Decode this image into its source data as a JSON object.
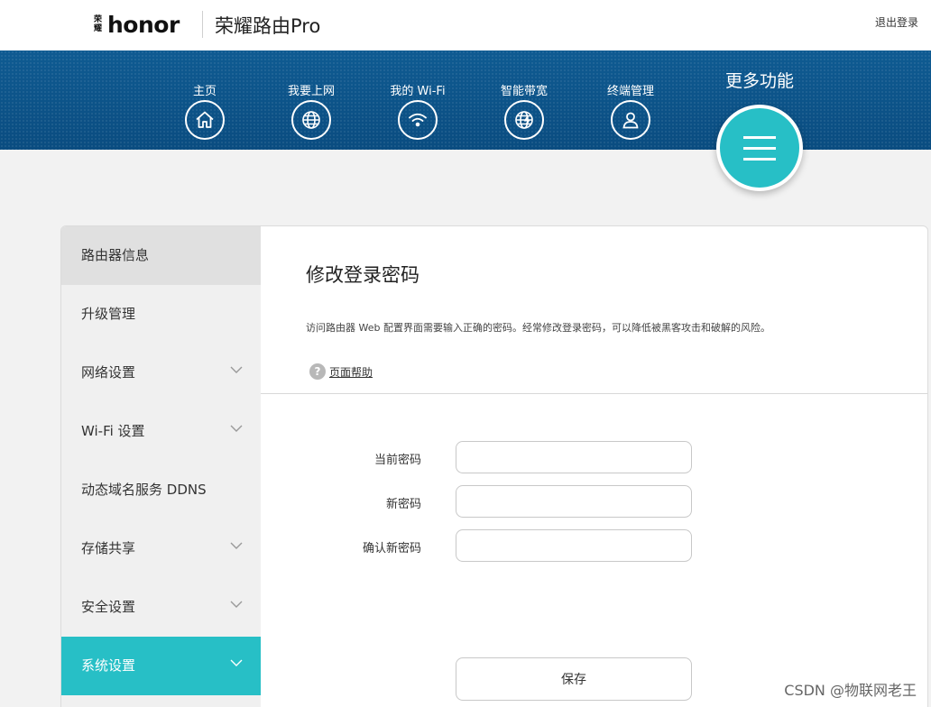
{
  "header": {
    "logo_mark": "荣耀",
    "logo_text": "honor",
    "product_title": "荣耀路由Pro",
    "logout_label": "退出登录"
  },
  "nav": {
    "items": [
      {
        "label": "主页",
        "icon": "home-icon"
      },
      {
        "label": "我要上网",
        "icon": "globe-icon"
      },
      {
        "label": "我的 Wi-Fi",
        "icon": "wifi-icon"
      },
      {
        "label": "智能带宽",
        "icon": "bandwidth-globe-icon"
      },
      {
        "label": "终端管理",
        "icon": "user-icon"
      }
    ],
    "more_label": "更多功能",
    "more_icon": "menu-icon"
  },
  "sidebar": {
    "items": [
      {
        "label": "路由器信息",
        "expandable": false,
        "state": "selected"
      },
      {
        "label": "升级管理",
        "expandable": false,
        "state": ""
      },
      {
        "label": "网络设置",
        "expandable": true,
        "state": ""
      },
      {
        "label": "Wi-Fi 设置",
        "expandable": true,
        "state": ""
      },
      {
        "label": "动态域名服务 DDNS",
        "expandable": false,
        "state": ""
      },
      {
        "label": "存储共享",
        "expandable": true,
        "state": ""
      },
      {
        "label": "安全设置",
        "expandable": true,
        "state": ""
      },
      {
        "label": "系统设置",
        "expandable": true,
        "state": "active"
      }
    ]
  },
  "content": {
    "title": "修改登录密码",
    "description": "访问路由器 Web 配置界面需要输入正确的密码。经常修改登录密码，可以降低被黑客攻击和破解的风险。",
    "help_label": "页面帮助",
    "help_icon_glyph": "?",
    "fields": [
      {
        "label": "当前密码",
        "value": ""
      },
      {
        "label": "新密码",
        "value": ""
      },
      {
        "label": "确认新密码",
        "value": ""
      }
    ],
    "save_label": "保存"
  },
  "watermark": "CSDN @物联网老王",
  "colors": {
    "accent": "#27bfc6",
    "nav_band": "#0f5b92"
  }
}
